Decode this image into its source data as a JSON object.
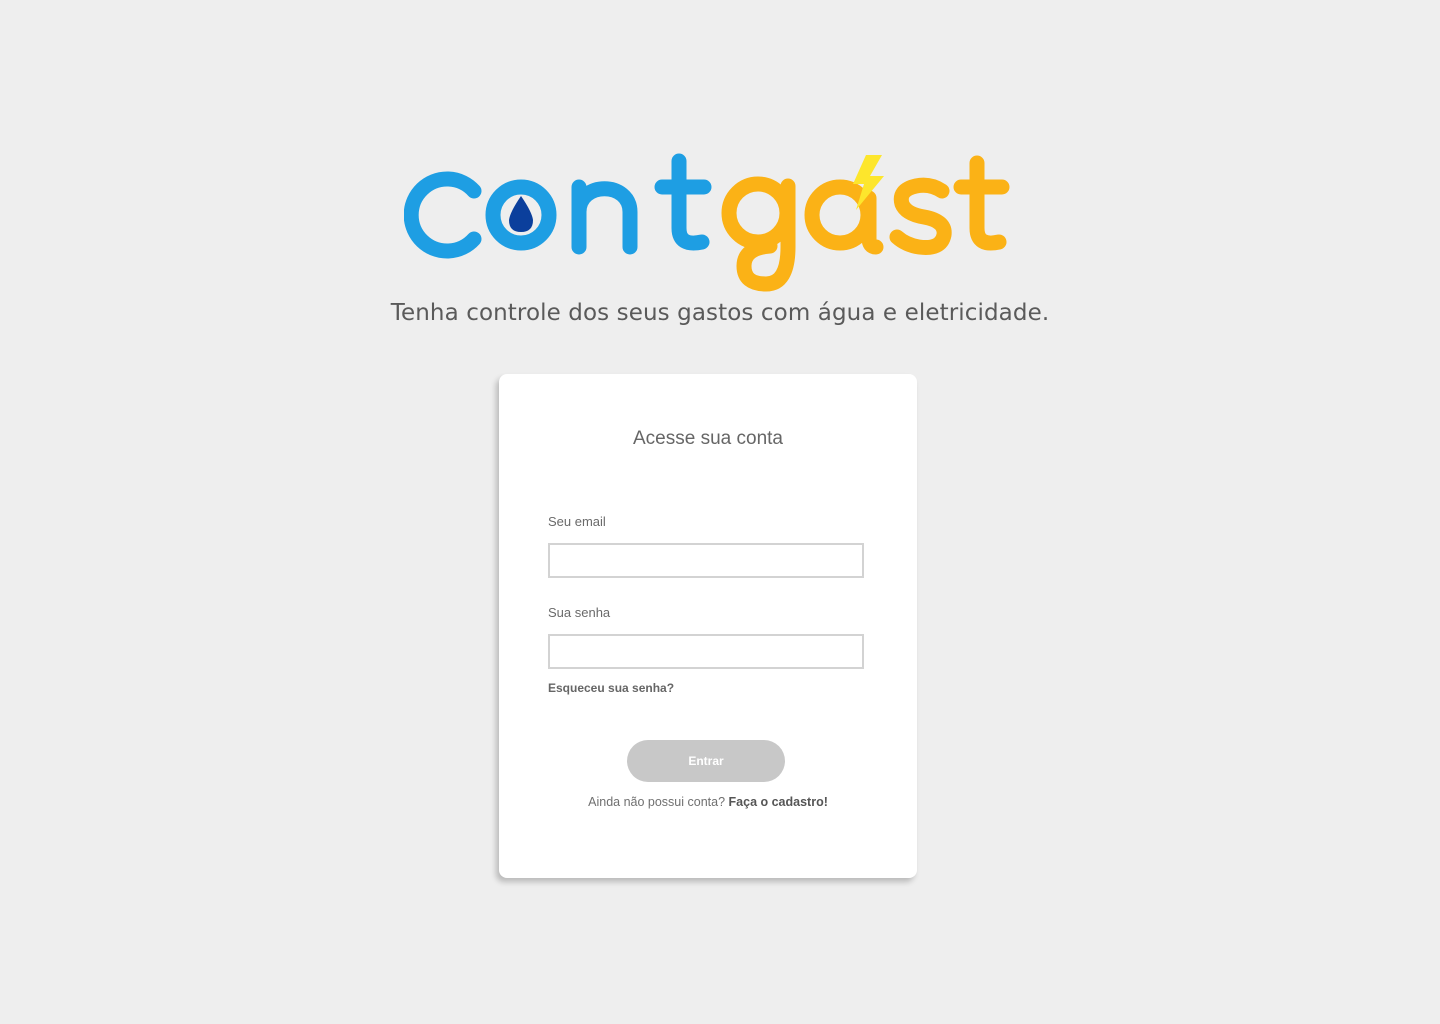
{
  "brand": {
    "logo_text": "contgast",
    "colors": {
      "blue": "#1e9ee3",
      "orange": "#fbb216",
      "drop": "#0b3f9c",
      "bolt": "#fde62c"
    }
  },
  "tagline": "Tenha controle dos seus gastos com água e eletricidade.",
  "login_card": {
    "title": "Acesse sua conta",
    "email_label": "Seu email",
    "email_value": "",
    "password_label": "Sua senha",
    "password_value": "",
    "forgot_link": "Esqueceu sua senha?",
    "submit_label": "Entrar",
    "signup_prompt": "Ainda não possui conta?",
    "signup_link": "Faça o cadastro!"
  },
  "colors": {
    "background": "#eeeeee",
    "card": "#ffffff",
    "button_disabled": "#c8c8c8"
  }
}
